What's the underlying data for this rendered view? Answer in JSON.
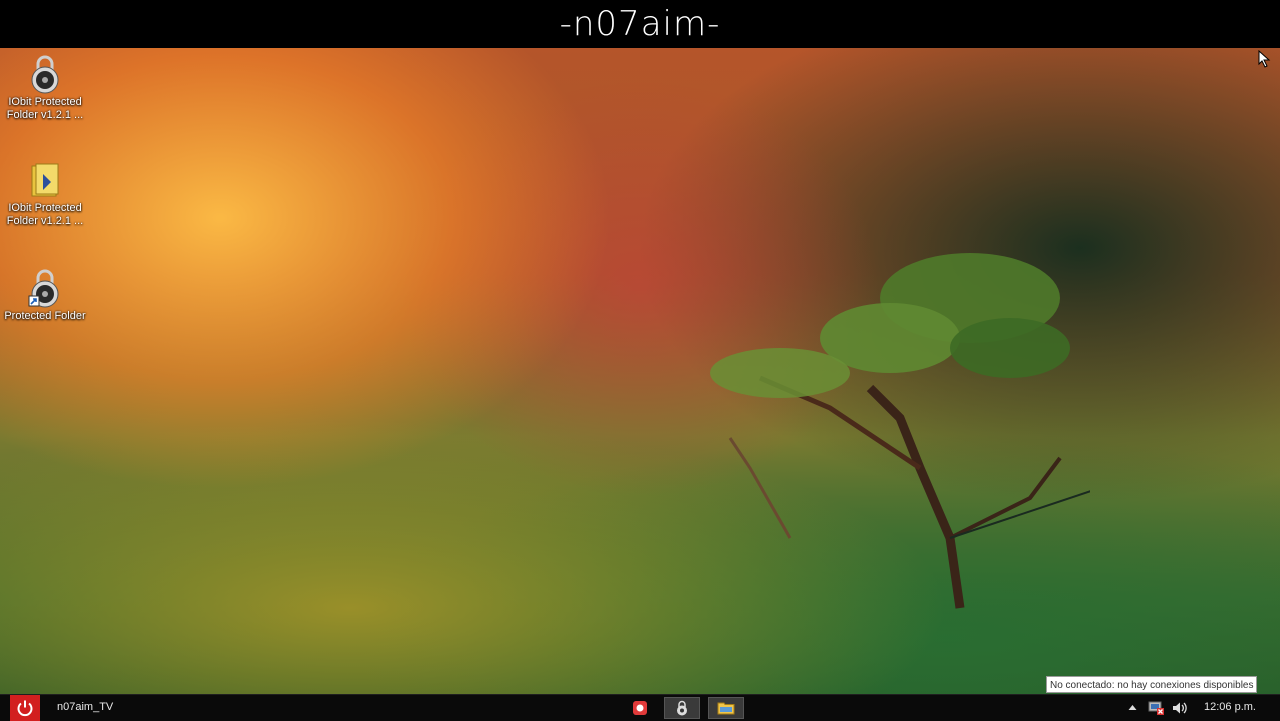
{
  "banner": {
    "title": "-n07aim-"
  },
  "desktop_icons": [
    {
      "label": "IObit Protected Folder v1.2.1 ...",
      "icon": "padlock-icon"
    },
    {
      "label": "IObit Protected Folder v1.2.1 ...",
      "icon": "folder-icon"
    },
    {
      "label": "Protected Folder",
      "icon": "padlock-shortcut-icon"
    }
  ],
  "taskbar": {
    "user_label": "n07aim_TV",
    "power_icon": "power-icon",
    "apps": [
      {
        "icon": "record-icon"
      },
      {
        "icon": "padlock-icon"
      },
      {
        "icon": "explorer-folder-icon"
      }
    ],
    "tray": {
      "show_hidden_icon": "chevron-up-icon",
      "network_icon": "network-disconnected-icon",
      "volume_icon": "speaker-icon",
      "clock": "12:06 p.m."
    },
    "tooltip": "No conectado: no hay conexiones disponibles"
  },
  "colors": {
    "power_red": "#d21f1f",
    "banner_bg": "#000000",
    "taskbar_bg": "#0a0a0a"
  }
}
